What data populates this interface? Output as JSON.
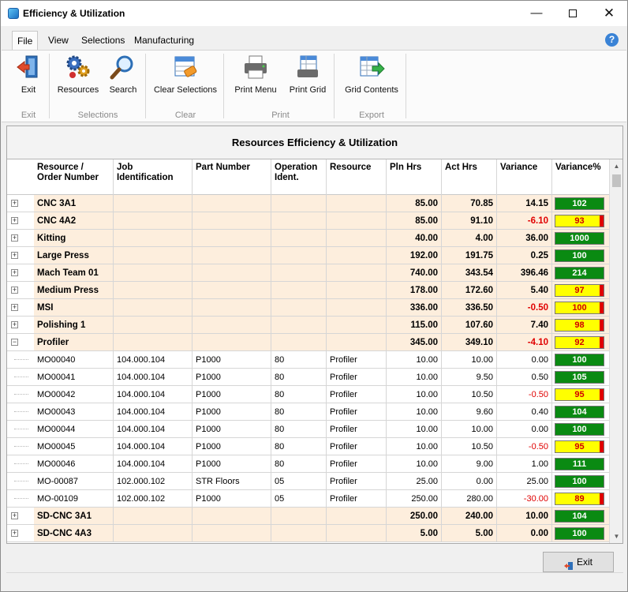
{
  "window": {
    "title": "Efficiency & Utilization"
  },
  "menu": [
    "File",
    "View",
    "Selections",
    "Manufacturing"
  ],
  "ribbon": {
    "buttons": [
      {
        "label": "Exit",
        "icon": "exit-door-icon"
      },
      {
        "label": "Resources",
        "icon": "resources-gears-icon"
      },
      {
        "label": "Search",
        "icon": "magnifier-icon"
      },
      {
        "label": "Clear Selections",
        "icon": "clear-selections-icon"
      },
      {
        "label": "Print Menu",
        "icon": "printer-icon"
      },
      {
        "label": "Print Grid",
        "icon": "print-grid-icon"
      },
      {
        "label": "Grid Contents",
        "icon": "export-grid-icon"
      }
    ],
    "groups": [
      "Exit",
      "Selections",
      "Clear",
      "Print",
      "Export"
    ]
  },
  "report_title": "Resources Efficiency & Utilization",
  "columns": [
    "Resource / Order Number",
    "Job Identification",
    "Part Number",
    "Operation Ident.",
    "Resource",
    "Pln Hrs",
    "Act Hrs",
    "Variance",
    "Variance%"
  ],
  "rows": [
    {
      "type": "group",
      "expander": "+",
      "name": "CNC 3A1",
      "job": "",
      "part": "",
      "op": "",
      "resource": "",
      "pln": "85.00",
      "act": "70.85",
      "var": "14.15",
      "pct": "102",
      "status": "green"
    },
    {
      "type": "group",
      "expander": "+",
      "name": "CNC 4A2",
      "job": "",
      "part": "",
      "op": "",
      "resource": "",
      "pln": "85.00",
      "act": "91.10",
      "var": "-6.10",
      "pct": "93",
      "status": "yellow"
    },
    {
      "type": "group",
      "expander": "+",
      "name": "Kitting",
      "job": "",
      "part": "",
      "op": "",
      "resource": "",
      "pln": "40.00",
      "act": "4.00",
      "var": "36.00",
      "pct": "1000",
      "status": "green"
    },
    {
      "type": "group",
      "expander": "+",
      "name": "Large Press",
      "job": "",
      "part": "",
      "op": "",
      "resource": "",
      "pln": "192.00",
      "act": "191.75",
      "var": "0.25",
      "pct": "100",
      "status": "green"
    },
    {
      "type": "group",
      "expander": "+",
      "name": "Mach Team 01",
      "job": "",
      "part": "",
      "op": "",
      "resource": "",
      "pln": "740.00",
      "act": "343.54",
      "var": "396.46",
      "pct": "214",
      "status": "green"
    },
    {
      "type": "group",
      "expander": "+",
      "name": "Medium Press",
      "job": "",
      "part": "",
      "op": "",
      "resource": "",
      "pln": "178.00",
      "act": "172.60",
      "var": "5.40",
      "pct": "97",
      "status": "yellow"
    },
    {
      "type": "group",
      "expander": "+",
      "name": "MSI",
      "job": "",
      "part": "",
      "op": "",
      "resource": "",
      "pln": "336.00",
      "act": "336.50",
      "var": "-0.50",
      "pct": "100",
      "status": "yellow"
    },
    {
      "type": "group",
      "expander": "+",
      "name": "Polishing 1",
      "job": "",
      "part": "",
      "op": "",
      "resource": "",
      "pln": "115.00",
      "act": "107.60",
      "var": "7.40",
      "pct": "98",
      "status": "yellow"
    },
    {
      "type": "group",
      "expander": "−",
      "name": "Profiler",
      "job": "",
      "part": "",
      "op": "",
      "resource": "",
      "pln": "345.00",
      "act": "349.10",
      "var": "-4.10",
      "pct": "92",
      "status": "yellow"
    },
    {
      "type": "child",
      "name": "MO00040",
      "job": "104.000.104",
      "part": "P1000",
      "op": "80",
      "resource": "Profiler",
      "pln": "10.00",
      "act": "10.00",
      "var": "0.00",
      "pct": "100",
      "status": "green"
    },
    {
      "type": "child",
      "name": "MO00041",
      "job": "104.000.104",
      "part": "P1000",
      "op": "80",
      "resource": "Profiler",
      "pln": "10.00",
      "act": "9.50",
      "var": "0.50",
      "pct": "105",
      "status": "green"
    },
    {
      "type": "child",
      "name": "MO00042",
      "job": "104.000.104",
      "part": "P1000",
      "op": "80",
      "resource": "Profiler",
      "pln": "10.00",
      "act": "10.50",
      "var": "-0.50",
      "pct": "95",
      "status": "yellow"
    },
    {
      "type": "child",
      "name": "MO00043",
      "job": "104.000.104",
      "part": "P1000",
      "op": "80",
      "resource": "Profiler",
      "pln": "10.00",
      "act": "9.60",
      "var": "0.40",
      "pct": "104",
      "status": "green"
    },
    {
      "type": "child",
      "name": "MO00044",
      "job": "104.000.104",
      "part": "P1000",
      "op": "80",
      "resource": "Profiler",
      "pln": "10.00",
      "act": "10.00",
      "var": "0.00",
      "pct": "100",
      "status": "green"
    },
    {
      "type": "child",
      "name": "MO00045",
      "job": "104.000.104",
      "part": "P1000",
      "op": "80",
      "resource": "Profiler",
      "pln": "10.00",
      "act": "10.50",
      "var": "-0.50",
      "pct": "95",
      "status": "yellow"
    },
    {
      "type": "child",
      "name": "MO00046",
      "job": "104.000.104",
      "part": "P1000",
      "op": "80",
      "resource": "Profiler",
      "pln": "10.00",
      "act": "9.00",
      "var": "1.00",
      "pct": "111",
      "status": "green"
    },
    {
      "type": "child",
      "name": "MO-00087",
      "job": "102.000.102",
      "part": "STR Floors",
      "op": "05",
      "resource": "Profiler",
      "pln": "25.00",
      "act": "0.00",
      "var": "25.00",
      "pct": "100",
      "status": "green"
    },
    {
      "type": "child",
      "name": "MO-00109",
      "job": "102.000.102",
      "part": "P1000",
      "op": "05",
      "resource": "Profiler",
      "pln": "250.00",
      "act": "280.00",
      "var": "-30.00",
      "pct": "89",
      "status": "yellow"
    },
    {
      "type": "group",
      "expander": "+",
      "name": "SD-CNC 3A1",
      "job": "",
      "part": "",
      "op": "",
      "resource": "",
      "pln": "250.00",
      "act": "240.00",
      "var": "10.00",
      "pct": "104",
      "status": "green"
    },
    {
      "type": "group",
      "expander": "+",
      "name": "SD-CNC 4A3",
      "job": "",
      "part": "",
      "op": "",
      "resource": "",
      "pln": "5.00",
      "act": "5.00",
      "var": "0.00",
      "pct": "100",
      "status": "green"
    }
  ],
  "footer": {
    "exit_label": "Exit",
    "exit_icon": "exit-small-icon"
  },
  "colors": {
    "group_row_bg": "#fdeedd",
    "good": "#0a8a12",
    "warn": "#ffff00",
    "negative": "#e00000"
  }
}
